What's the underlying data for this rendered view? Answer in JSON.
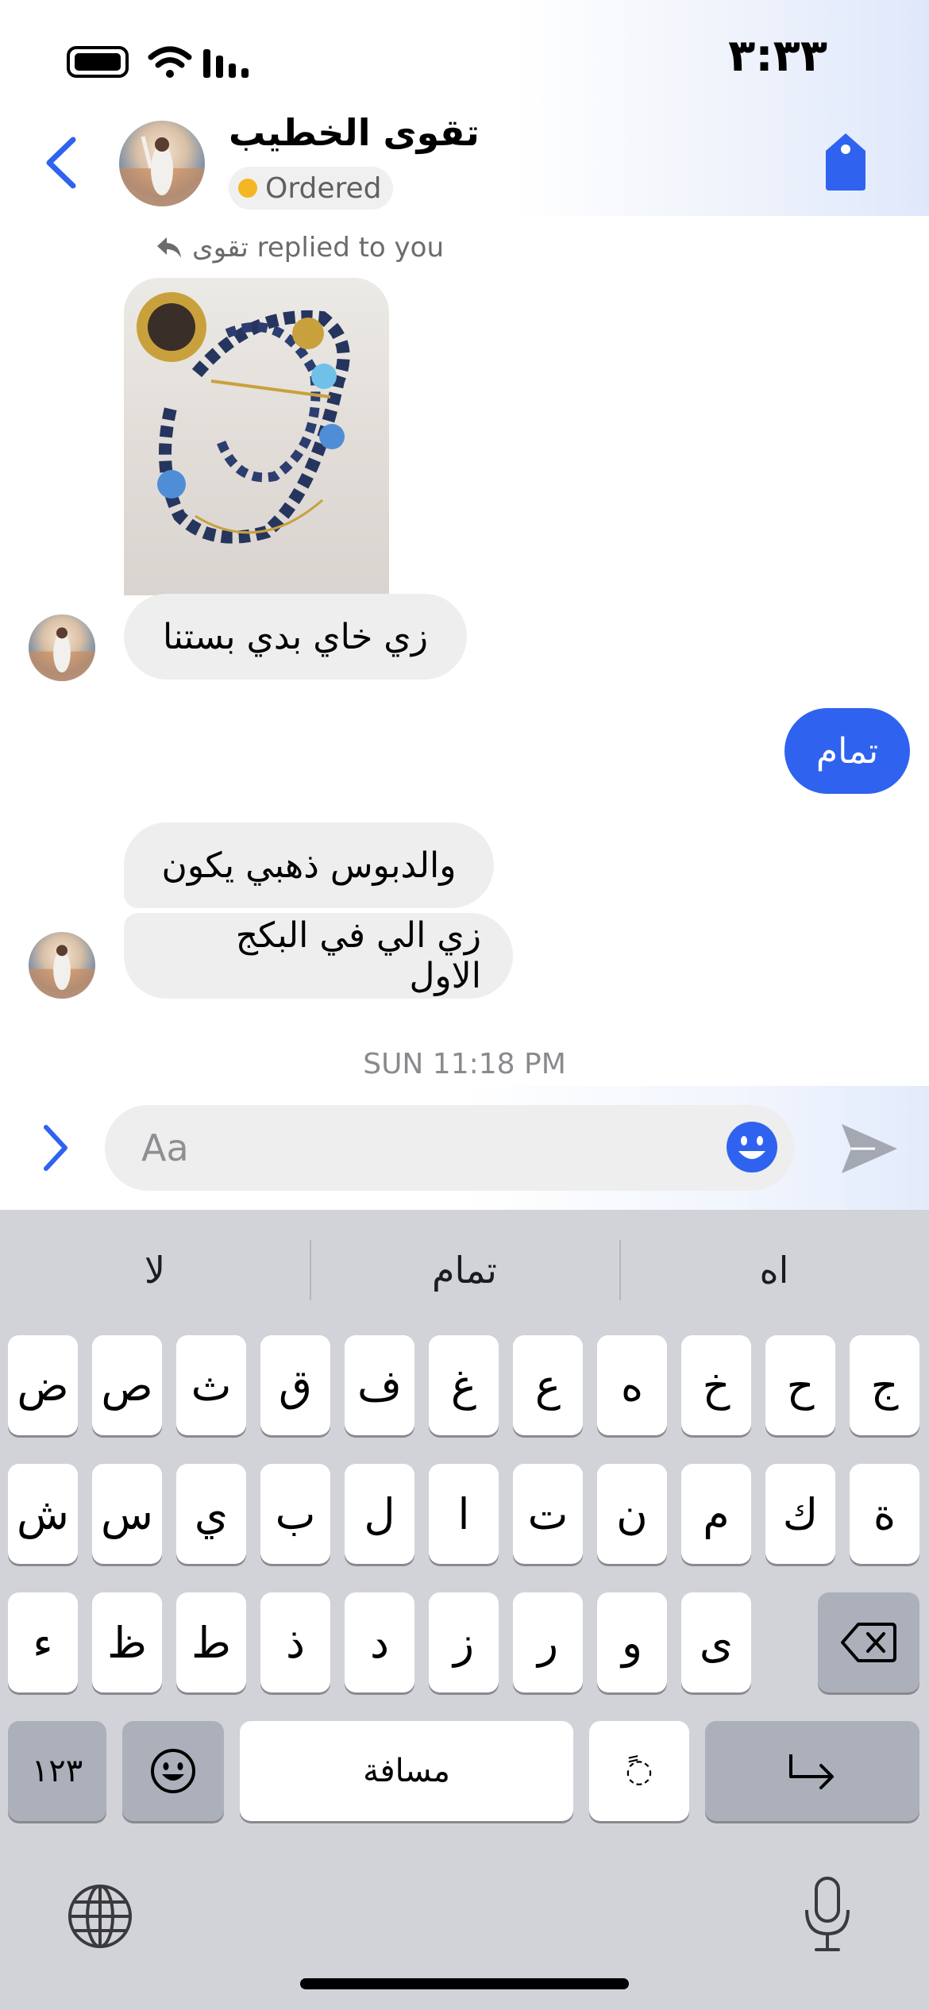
{
  "status_bar": {
    "time": "٣:٣٣"
  },
  "header": {
    "contact_name": "تقوى الخطيب",
    "order_status": "Ordered",
    "order_status_color": "#f5b623",
    "accent_color": "#2f63ef"
  },
  "chat": {
    "replied_note": "تقوى replied to you",
    "messages": [
      {
        "direction": "in",
        "text": "زي خاي بدي بستنا"
      },
      {
        "direction": "out",
        "text": "تمام"
      },
      {
        "direction": "in",
        "text": "والدبوس ذهبي يكون"
      },
      {
        "direction": "in",
        "text": "زي الي في البكج الاول"
      }
    ],
    "timestamp": "SUN 11:18 PM"
  },
  "composer": {
    "placeholder": "Aa"
  },
  "keyboard": {
    "suggestions": [
      "لا",
      "تمام",
      "اه"
    ],
    "row1": [
      "ض",
      "ص",
      "ث",
      "ق",
      "ف",
      "غ",
      "ع",
      "ه",
      "خ",
      "ح",
      "ج"
    ],
    "row2": [
      "ش",
      "س",
      "ي",
      "ب",
      "ل",
      "ا",
      "ت",
      "ن",
      "م",
      "ك",
      "ة"
    ],
    "row3": [
      "ء",
      "ظ",
      "ط",
      "ذ",
      "د",
      "ز",
      "ر",
      "و",
      "ى"
    ],
    "numbers_key": "١٢٣",
    "space_key": "مسافة",
    "diacritic_key": "ً◌"
  }
}
